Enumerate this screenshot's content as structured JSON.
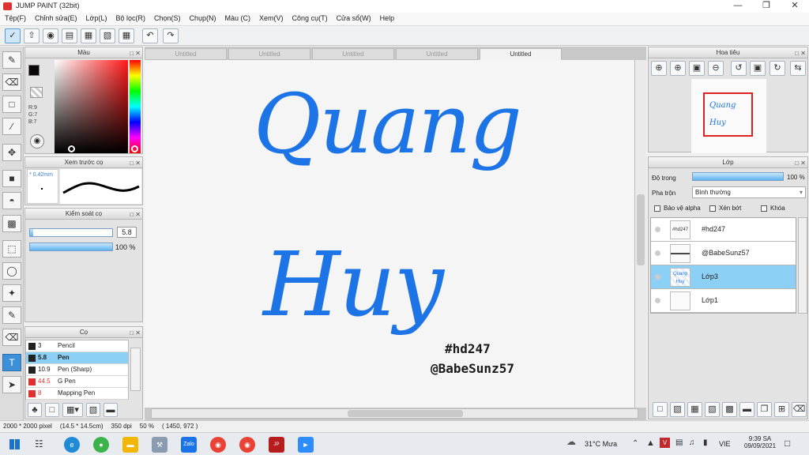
{
  "window": {
    "title": "JUMP PAINT (32bit)"
  },
  "menu": [
    "Tệp(F)",
    "Chỉnh sửa(E)",
    "Lớp(L)",
    "Bộ lọc(R)",
    "Chọn(S)",
    "Chụp(N)",
    "Màu (C)",
    "Xem(V)",
    "Công cụ(T)",
    "Cửa sổ(W)",
    "Help"
  ],
  "color_panel": {
    "title": "Màu",
    "r": "R:9",
    "g": "G:7",
    "b": "B:7",
    "foreground": "#090707",
    "background": "#1a6fe8"
  },
  "preview_panel": {
    "title": "Xem trước cọ",
    "size": "0.42mm"
  },
  "control_panel": {
    "title": "Kiểm soát cọ",
    "size_value": "5.8",
    "opacity_value": "100 %",
    "size_fraction": 0.04,
    "opacity_fraction": 1.0
  },
  "brush_panel": {
    "title": "Cọ",
    "brushes": [
      {
        "size": "3",
        "name": "Pencil",
        "color": "#222222",
        "selected": false
      },
      {
        "size": "5.8",
        "name": "Pen",
        "color": "#222222",
        "selected": true
      },
      {
        "size": "10.9",
        "name": "Pen (Sharp)",
        "color": "#222222",
        "selected": false
      },
      {
        "size": "44.5",
        "name": "G Pen",
        "color": "#e03030",
        "selected": false
      },
      {
        "size": "8",
        "name": "Mapping Pen",
        "color": "#e03030",
        "selected": false
      }
    ]
  },
  "tabs": [
    "Untitled",
    "Untitled",
    "Untitled",
    "Untitled",
    "Untitled"
  ],
  "canvas": {
    "line1": "Quang",
    "line2": "Huy",
    "tag1": "#hd247",
    "tag2": "@BabeSunz57"
  },
  "navigator": {
    "title": "Hoa tiêu"
  },
  "layer_panel": {
    "title": "Lớp",
    "opacity_label": "Độ trong",
    "opacity_value": "100 %",
    "opacity_fraction": 1.0,
    "blend_label": "Pha trộn",
    "blend_value": "Bình thường",
    "protect_alpha": "Bảo vệ alpha",
    "clip": "Xén bớt",
    "lock": "Khóa",
    "layers": [
      {
        "name": "#hd247",
        "thumb": "#hd247",
        "selected": false
      },
      {
        "name": "@BabeSunz57",
        "thumb": "▬▬▬▬",
        "selected": false
      },
      {
        "name": "Lớp3",
        "thumb": "Quang Huy",
        "selected": true
      },
      {
        "name": "Lớp1",
        "thumb": "",
        "selected": false
      }
    ]
  },
  "status": {
    "size": "2000 * 2000 pixel",
    "cm": "(14.5 * 14.5cm)",
    "dpi": "350 dpi",
    "zoom": "50 %",
    "coords": "( 1450, 972 )"
  },
  "taskbar": {
    "weather": "31°C  Mưa",
    "lang": "VIE",
    "time": "9:39 SA",
    "date": "09/09/2021"
  }
}
